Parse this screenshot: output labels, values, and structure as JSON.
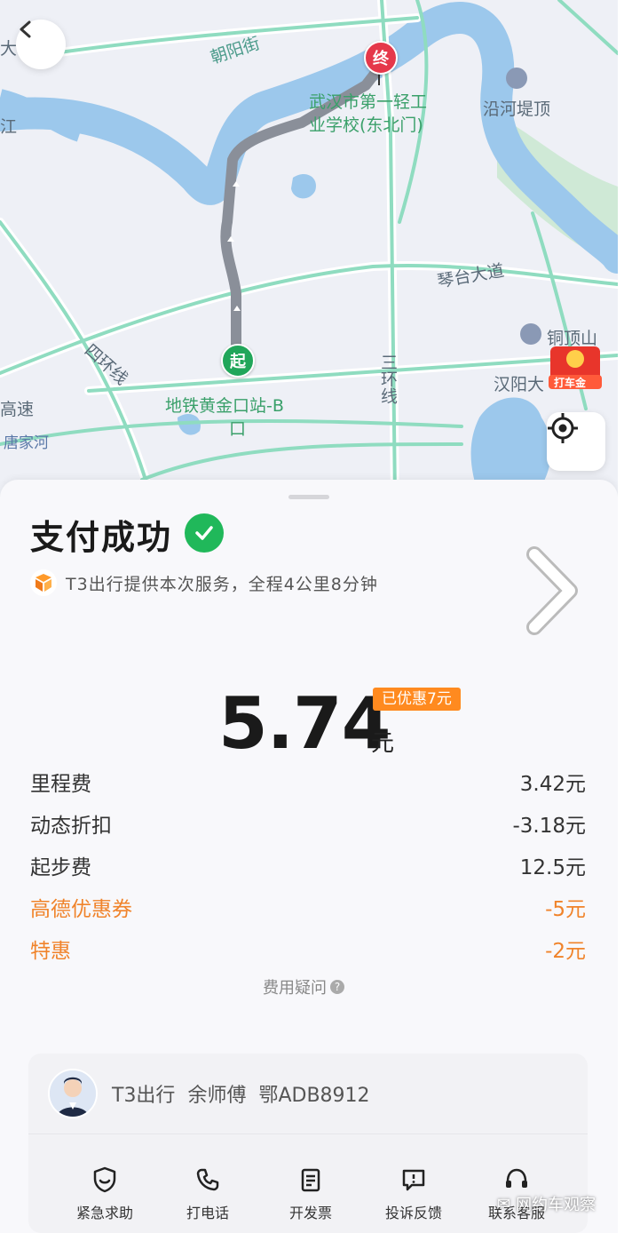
{
  "map": {
    "labels": {
      "road_chaoyang": "朝阳街",
      "destination_name": "武汉市第一轻工业学校(东北门)",
      "destination_line1": "武汉市第一轻工",
      "destination_line2": "业学校(东北门)",
      "yanhe_diding": "沿河堤顶",
      "qintai_avenue": "琴台大道",
      "tongdingshan": "铜顶山",
      "hanyang": "汉阳大",
      "sanhuanxian": "三环线",
      "sihuanxian": "四环线",
      "gaosu": "高速",
      "tangjiahe": "唐家河",
      "start_line1": "地铁黄金口站-B",
      "start_line2": "口",
      "jiang": "江",
      "da": "大"
    },
    "pin_end": "终",
    "pin_start": "起",
    "red_packet_label": "打车金"
  },
  "sheet": {
    "title": "支付成功",
    "service_text": "T3出行提供本次服务，全程4公里8分钟",
    "amount": "5.74",
    "amount_unit": "元",
    "discount_badge": "已优惠7元",
    "fees": [
      {
        "label": "里程费",
        "value": "3.42元",
        "highlight": false
      },
      {
        "label": "动态折扣",
        "value": "-3.18元",
        "highlight": false
      },
      {
        "label": "起步费",
        "value": "12.5元",
        "highlight": false
      },
      {
        "label": "高德优惠券",
        "value": "-5元",
        "highlight": true
      },
      {
        "label": "特惠",
        "value": "-2元",
        "highlight": true
      }
    ],
    "fee_help": "费用疑问",
    "driver": {
      "company": "T3出行",
      "name": "余师傅",
      "plate": "鄂ADB8912"
    },
    "actions": [
      {
        "label": "紧急求助",
        "icon": "shield-icon"
      },
      {
        "label": "打电话",
        "icon": "phone-icon"
      },
      {
        "label": "开发票",
        "icon": "invoice-icon"
      },
      {
        "label": "投诉反馈",
        "icon": "feedback-icon"
      },
      {
        "label": "联系客服",
        "icon": "headset-icon"
      }
    ],
    "watermark": "网约车观察"
  },
  "colors": {
    "success_green": "#20b85a",
    "accent_orange": "#f0832a",
    "badge_orange": "#ff8a1f",
    "river_blue": "#9cc8ec",
    "road_green": "#8fdcc0",
    "route_gray": "#8a8f99"
  }
}
